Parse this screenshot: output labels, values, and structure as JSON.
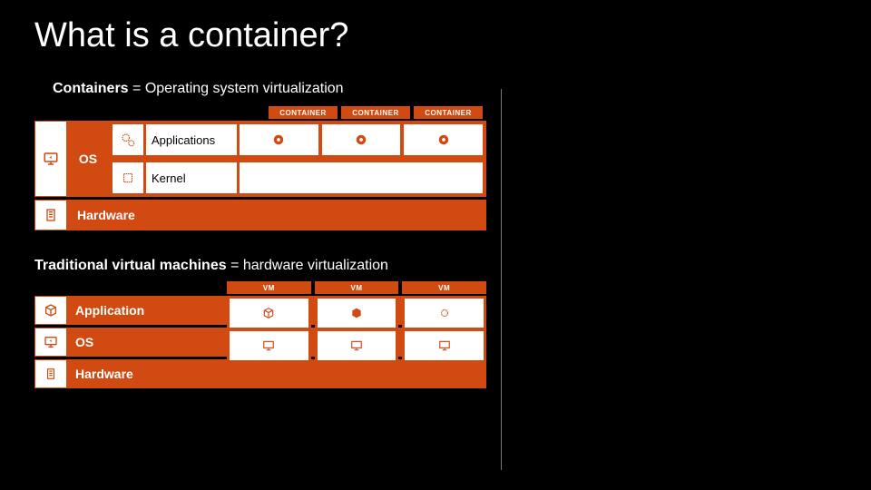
{
  "title": "What is a container?",
  "section1": {
    "heading_bold": "Containers",
    "heading_rest": " = Operating system virtualization",
    "container_badges": [
      "CONTAINER",
      "CONTAINER",
      "CONTAINER"
    ],
    "os_label": "OS",
    "apps_label": "Applications",
    "kernel_label": "Kernel",
    "hardware_label": "Hardware"
  },
  "section2": {
    "heading_bold": "Traditional virtual machines",
    "heading_rest": " = hardware virtualization",
    "vm_badges": [
      "VM",
      "VM",
      "VM"
    ],
    "application_label": "Application",
    "os_label": "OS",
    "hardware_label": "Hardware"
  }
}
